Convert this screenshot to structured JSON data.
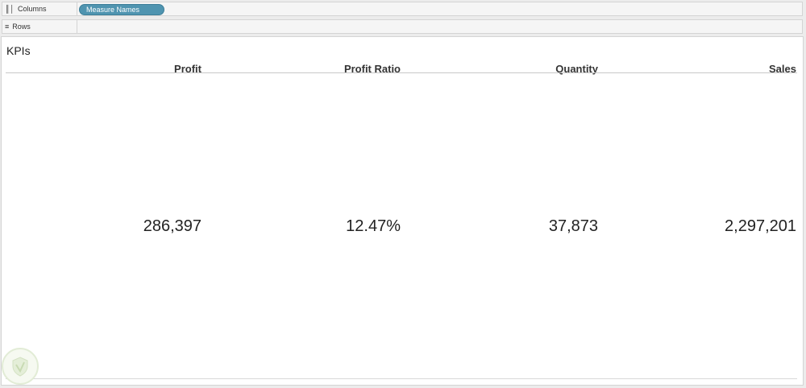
{
  "shelves": {
    "columns": {
      "label": "Columns",
      "icon": "columns-icon",
      "pill": "Measure Names"
    },
    "rows": {
      "label": "Rows",
      "icon": "rows-icon"
    }
  },
  "sheet": {
    "title": "KPIs",
    "columns": [
      {
        "header": "Profit",
        "value": "286,397"
      },
      {
        "header": "Profit Ratio",
        "value": "12.47%"
      },
      {
        "header": "Quantity",
        "value": "37,873"
      },
      {
        "header": "Sales",
        "value": "2,297,201"
      }
    ]
  },
  "colors": {
    "pill": "#4f94b0",
    "background": "#ececec",
    "sheet": "#ffffff"
  }
}
